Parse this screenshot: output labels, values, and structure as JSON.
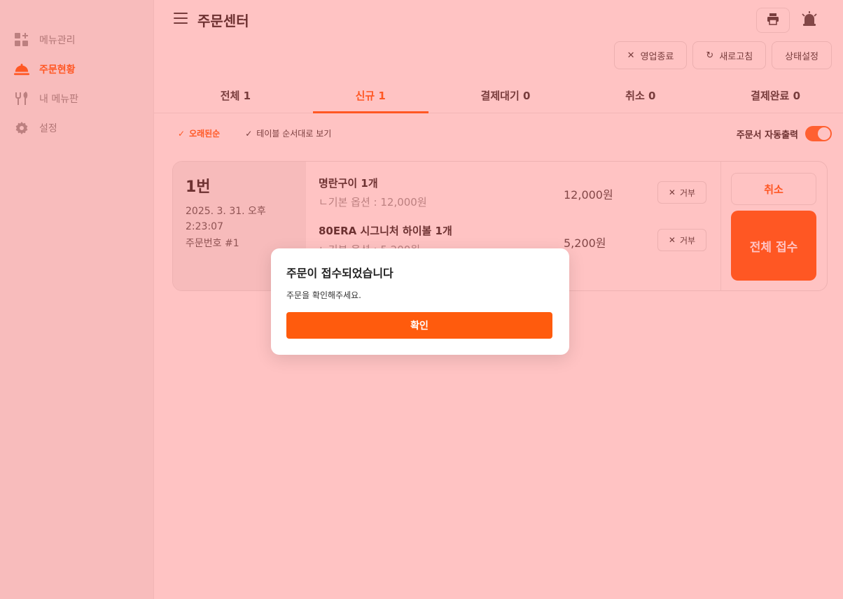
{
  "colors": {
    "accent": "#ff5b0d",
    "overlay": "rgba(255,80,80,0.34)",
    "sidebar_bg": "#f5f5f5"
  },
  "sidebar": {
    "items": [
      {
        "label": "메뉴관리",
        "icon": "dashboard-plus-icon",
        "active": false
      },
      {
        "label": "주문현황",
        "icon": "cloche-icon",
        "active": true
      },
      {
        "label": "내 메뉴판",
        "icon": "fork-knife-icon",
        "active": false
      },
      {
        "label": "설정",
        "icon": "gear-icon",
        "active": false
      }
    ]
  },
  "header": {
    "title": "주문센터",
    "icons": [
      "menu-icon",
      "print-icon",
      "bell-alarm-icon"
    ]
  },
  "actions": {
    "close_label": "영업종료",
    "refresh_label": "새로고침",
    "status_label": "상태설정"
  },
  "tabs": [
    {
      "label": "전체 1",
      "active": false
    },
    {
      "label": "신규 1",
      "active": true
    },
    {
      "label": "결제대기 0",
      "active": false
    },
    {
      "label": "취소 0",
      "active": false
    },
    {
      "label": "결제완료 0",
      "active": false
    }
  ],
  "filters": {
    "oldest": "오래된순",
    "by_table": "테이블 순서대로 보기"
  },
  "auto_print": {
    "label": "주문서 자동출력",
    "enabled": true
  },
  "order": {
    "table": "1번",
    "datetime": "2025. 3. 31. 오후 2:23:07",
    "order_id": "주문번호 #1",
    "items": [
      {
        "name": "명란구이 1개",
        "option": "ㄴ기본 옵션 : 12,000원",
        "price": "12,000원",
        "reject_label": "거부"
      },
      {
        "name": "80ERA 시그니처 하이볼 1개",
        "option": "ㄴ기본 옵션 : 5,200원",
        "price": "5,200원",
        "reject_label": "거부"
      }
    ],
    "cancel_label": "취소",
    "accept_label": "전체 접수"
  },
  "modal": {
    "title": "주문이 접수되었습니다",
    "message": "주문을 확인해주세요.",
    "confirm_label": "확인"
  }
}
